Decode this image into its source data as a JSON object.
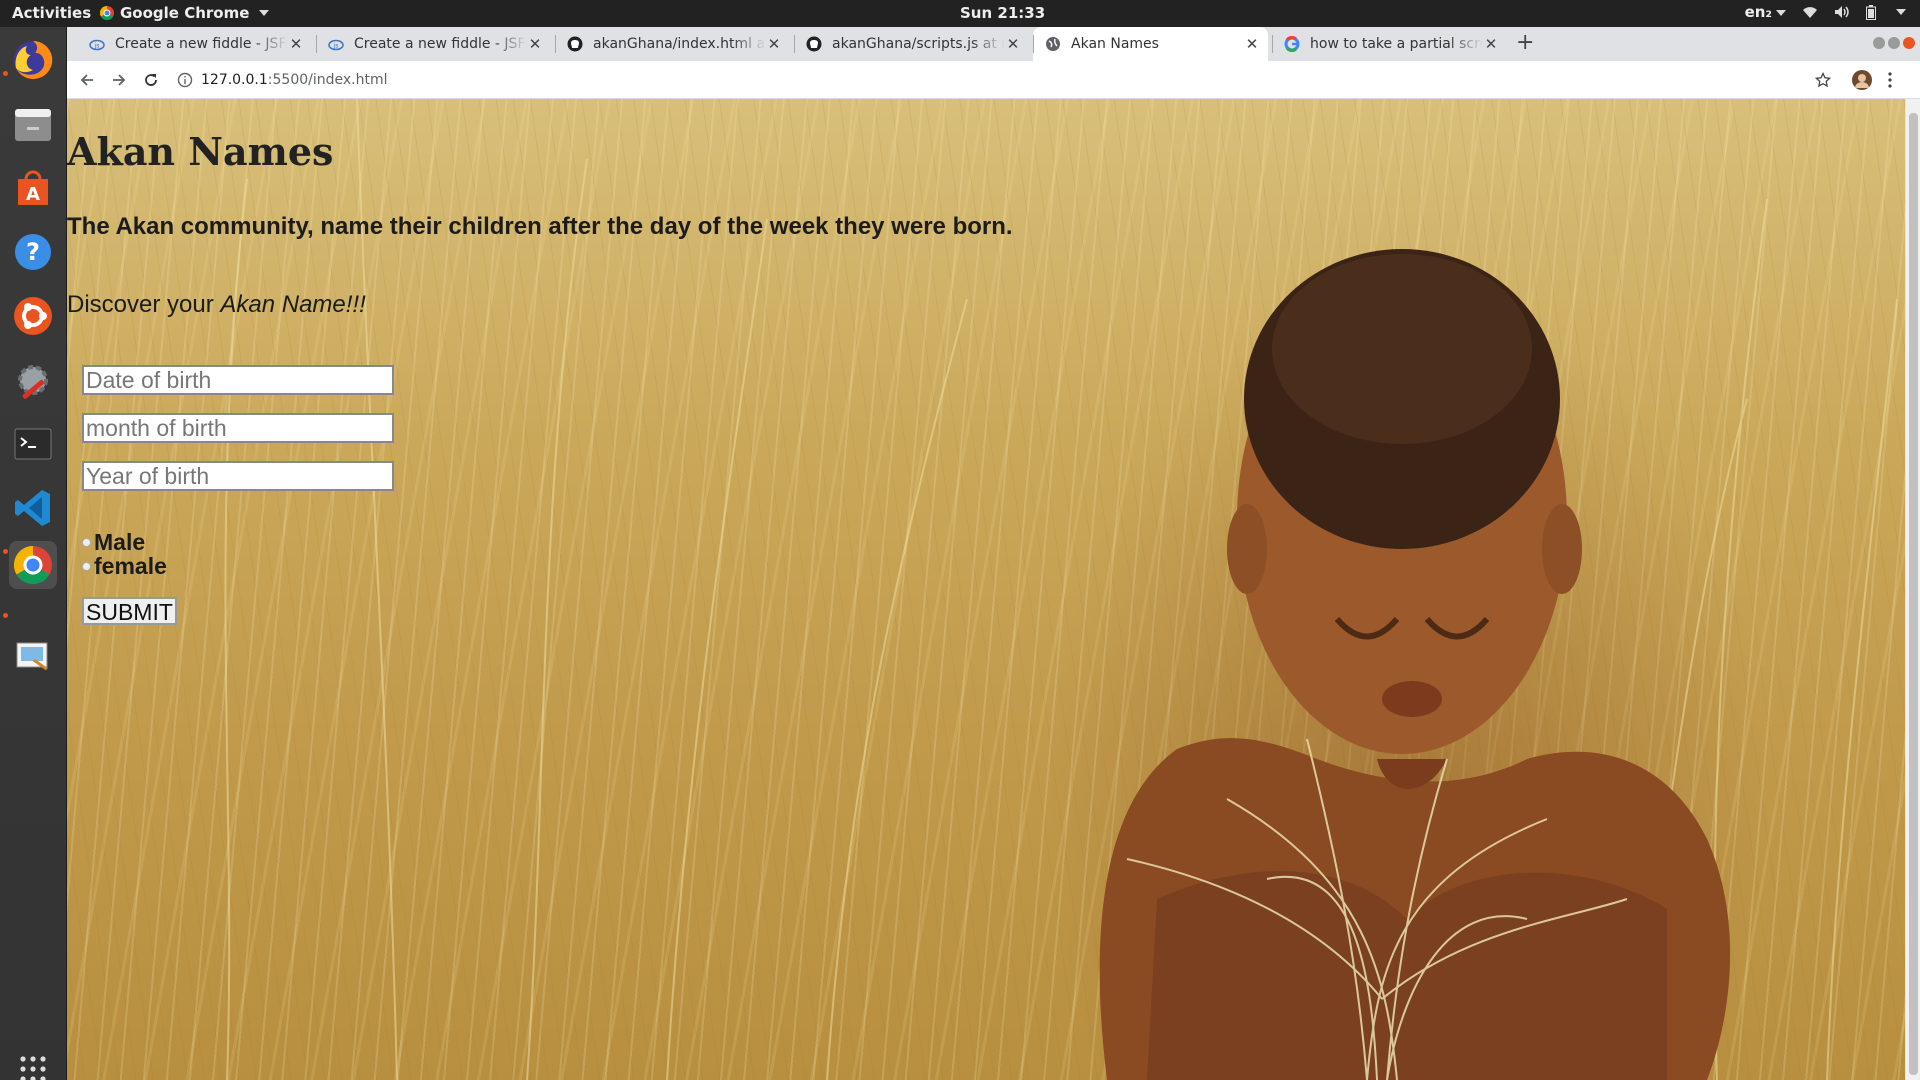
{
  "topbar": {
    "activities": "Activities",
    "app_name": "Google Chrome",
    "clock": "Sun 21:33",
    "keyboard_layout": "en₂"
  },
  "dock": {
    "items": [
      "firefox-icon",
      "files-icon",
      "software-center-icon",
      "help-icon",
      "ubuntu-settings-icon",
      "system-tools-icon",
      "terminal-icon",
      "vscode-icon",
      "chrome-icon",
      "screenshot-icon"
    ],
    "show_apps_icon": "grid-icon"
  },
  "tabs": [
    {
      "title": "Create a new fiddle - JSFiddle",
      "icon": "jsfiddle-icon"
    },
    {
      "title": "Create a new fiddle - JSFiddle",
      "icon": "jsfiddle-icon"
    },
    {
      "title": "akanGhana/index.html at master",
      "icon": "github-icon"
    },
    {
      "title": "akanGhana/scripts.js at master",
      "icon": "github-icon"
    },
    {
      "title": "Akan Names",
      "icon": "globe-icon",
      "active": true
    },
    {
      "title": "how to take a partial screenshot",
      "icon": "google-icon"
    }
  ],
  "toolbar": {
    "url_host": "127.0.0.1",
    "url_path": ":5500/index.html"
  },
  "page": {
    "heading": "Akan Names",
    "subheading": "The Akan community, name their children after the day of the week they were born.",
    "intro_prefix": "Discover your ",
    "intro_emphasis": "Akan Name!!!",
    "form": {
      "date_placeholder": "Date of birth",
      "month_placeholder": "month of birth",
      "year_placeholder": "Year of birth",
      "male_label": "Male",
      "female_label": "female",
      "submit_label": "SUBMIT"
    }
  },
  "colors": {
    "ubuntu_orange": "#e95420",
    "tab_strip": "#dfe1e5"
  }
}
